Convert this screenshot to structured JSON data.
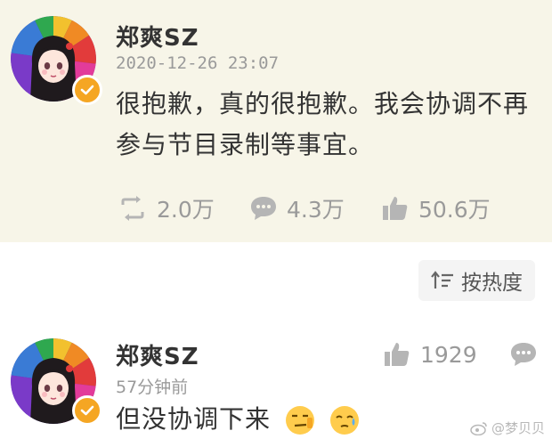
{
  "post": {
    "author": "郑爽SZ",
    "timestamp": "2020-12-26 23:07",
    "content_line1": "很抱歉，真的很抱歉。我会协调不再",
    "content_line2": "参与节目录制等事宜。",
    "repost_count": "2.0万",
    "comment_count": "4.3万",
    "like_count": "50.6万",
    "badge_color": "#f5a623"
  },
  "sort": {
    "label": "按热度"
  },
  "comment": {
    "author": "郑爽SZ",
    "time": "57分钟前",
    "text": "但没协调下来",
    "like_count": "1929"
  },
  "watermark": {
    "text": "@梦贝贝"
  },
  "icons": [
    "verified-badge-icon",
    "repost-icon",
    "comment-icon",
    "like-icon",
    "sort-icon",
    "reply-icon",
    "emoji-smirk-icon",
    "emoji-sweat-icon",
    "weibo-logo-icon"
  ]
}
